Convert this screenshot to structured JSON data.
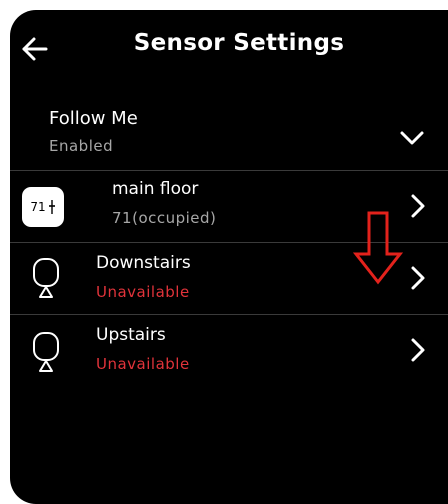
{
  "header": {
    "title": "Sensor Settings",
    "back_icon": "arrow-left-icon"
  },
  "follow_me": {
    "title": "Follow Me",
    "status": "Enabled",
    "expand_icon": "chevron-down-icon"
  },
  "sensors": [
    {
      "name": "main floor",
      "status": "71(occupied)",
      "icon": "thermostat-icon",
      "icon_text": "71",
      "status_color": "#a7a7a7"
    },
    {
      "name": "Downstairs",
      "status": "Unavailable",
      "icon": "room-sensor-icon",
      "status_color": "#e0333a"
    },
    {
      "name": "Upstairs",
      "status": "Unavailable",
      "icon": "room-sensor-icon",
      "status_color": "#e0333a"
    }
  ],
  "annotation": {
    "icon": "red-down-arrow-icon",
    "color": "#e3221c"
  },
  "colors": {
    "background": "#000000",
    "text": "#ffffff",
    "muted": "#a7a7a7",
    "error": "#e0333a",
    "divider": "#3a3a3a"
  }
}
